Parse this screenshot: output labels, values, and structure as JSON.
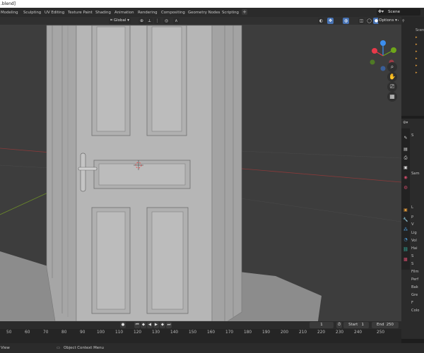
{
  "window": {
    "title": ".blend]"
  },
  "workspaces": [
    "Modeling",
    "Sculpting",
    "UV Editing",
    "Texture Paint",
    "Shading",
    "Animation",
    "Rendering",
    "Compositing",
    "Geometry Nodes",
    "Scripting"
  ],
  "workspace_add": "+",
  "scene": {
    "label": "Scene"
  },
  "viewport_header": {
    "transform_orientation": "Global",
    "options_label": "Options"
  },
  "navigation_gizmo": {
    "x_color": "#e8394a",
    "y_color": "#6ea61a",
    "z_color": "#3b8ef0",
    "neg_x_color": "#9b3a44",
    "neg_y_color": "#4f7a25",
    "neg_z_color": "#3a5f99"
  },
  "outliner": {
    "header_label": "Scen"
  },
  "properties": {
    "top_label": "S",
    "items": [
      "Sam",
      "L",
      "P",
      "V",
      "Lig",
      "Vol",
      "Hai",
      "S",
      "S",
      "Film",
      "Perf",
      "Bak",
      "Gre",
      "F",
      "Colo"
    ]
  },
  "timeline": {
    "current_frame": "1",
    "start_label": "Start",
    "start_value": "1",
    "end_label": "End",
    "end_value": "250",
    "frame_ticks": [
      "50",
      "60",
      "70",
      "80",
      "90",
      "100",
      "110",
      "120",
      "130",
      "140",
      "150",
      "160",
      "170",
      "180",
      "190",
      "200",
      "210",
      "220",
      "230",
      "240",
      "250"
    ]
  },
  "status": {
    "left": "View",
    "context_menu": "Object Context Menu"
  },
  "colors": {
    "viewport_bg": "#3d3d3d",
    "grid_red": "#8a3a3a",
    "grid_green": "#6b8a2a",
    "door_fill": "#b4b4b4",
    "floor_fill": "#8c8c8c",
    "accent_blue": "#4772b3"
  }
}
